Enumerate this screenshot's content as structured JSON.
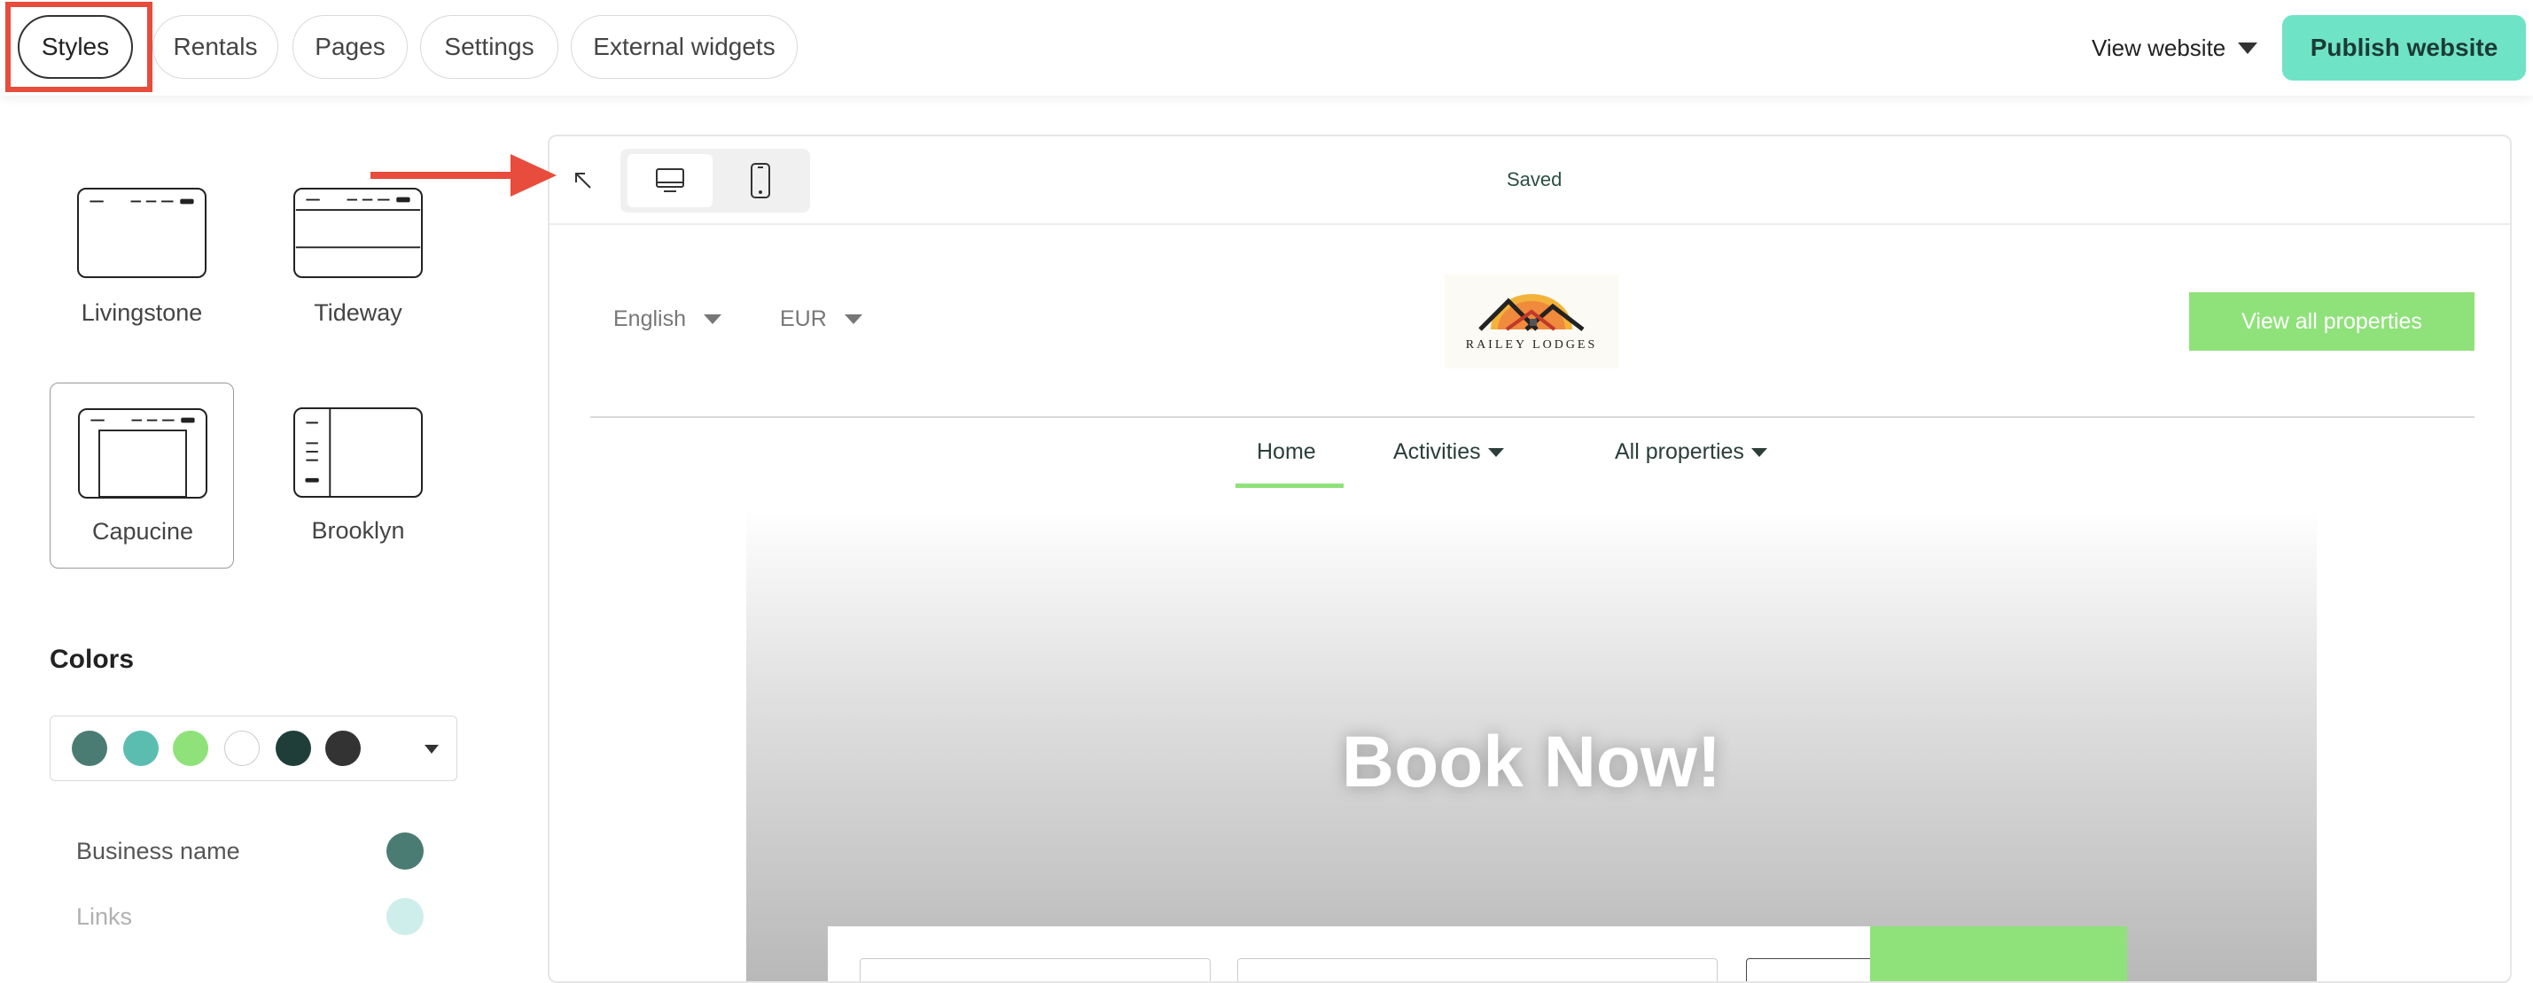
{
  "topbar": {
    "tabs": [
      {
        "label": "Styles",
        "active": true
      },
      {
        "label": "Rentals",
        "active": false
      },
      {
        "label": "Pages",
        "active": false
      },
      {
        "label": "Settings",
        "active": false
      },
      {
        "label": "External widgets",
        "active": false
      }
    ],
    "view_website_label": "View website",
    "publish_label": "Publish website"
  },
  "sidebar": {
    "themes": [
      {
        "label": "Livingstone",
        "selected": false
      },
      {
        "label": "Tideway",
        "selected": false
      },
      {
        "label": "Capucine",
        "selected": true
      },
      {
        "label": "Brooklyn",
        "selected": false
      }
    ],
    "colors_title": "Colors",
    "palette": [
      "#4a7c74",
      "#5bbdb0",
      "#8fe27a",
      "#ffffff",
      "#1f3e39",
      "#333333"
    ],
    "color_rows": [
      {
        "label": "Business name",
        "color": "#4a7c74"
      },
      {
        "label": "Links",
        "color": "#a8dcd6"
      }
    ]
  },
  "preview": {
    "status": "Saved",
    "site": {
      "language": "English",
      "currency": "EUR",
      "logo_text": "RAILEY LODGES",
      "cta_label": "View all properties",
      "nav": [
        {
          "label": "Home",
          "active": true
        },
        {
          "label": "Activities",
          "has_dropdown": true
        },
        {
          "label": "All properties",
          "has_dropdown": true
        }
      ],
      "hero_title": "Book Now!"
    }
  },
  "colors": {
    "accent": "#6fe3c6",
    "site_green": "#8fe27a",
    "annotation_red": "#e74c3c"
  }
}
